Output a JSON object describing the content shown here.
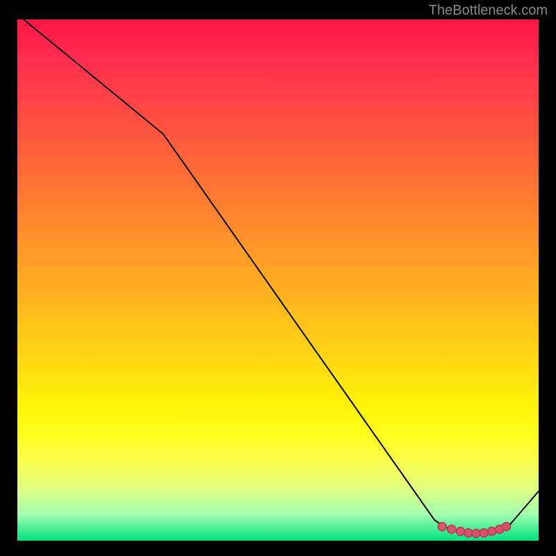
{
  "attribution": "TheBottleneck.com",
  "chart_data": {
    "type": "line",
    "title": "",
    "xlabel": "",
    "ylabel": "",
    "xlim": [
      0,
      100
    ],
    "ylim": [
      0,
      100
    ],
    "series": [
      {
        "name": "curve",
        "color": "#000000",
        "stroke_width": 2,
        "x": [
          0,
          28,
          80,
          82,
          84,
          86,
          88,
          90,
          92,
          94,
          100
        ],
        "y": [
          101,
          78,
          4,
          2.6,
          2.1,
          1.7,
          1.5,
          1.6,
          1.9,
          2.5,
          9.5
        ]
      }
    ],
    "markers": {
      "name": "highlight",
      "color": "#d9536b",
      "stroke": "#b03a52",
      "radius": 6,
      "x": [
        81.5,
        83.3,
        85.0,
        86.5,
        88.0,
        89.5,
        91.0,
        92.5,
        93.8
      ],
      "y": [
        2.7,
        2.2,
        1.8,
        1.5,
        1.4,
        1.5,
        1.8,
        2.2,
        2.7
      ]
    },
    "background": {
      "type": "vertical-gradient",
      "stops": [
        {
          "pos": 0.0,
          "color": "#ff1744"
        },
        {
          "pos": 0.5,
          "color": "#ffb020"
        },
        {
          "pos": 0.8,
          "color": "#ffff20"
        },
        {
          "pos": 1.0,
          "color": "#00e080"
        }
      ]
    }
  }
}
